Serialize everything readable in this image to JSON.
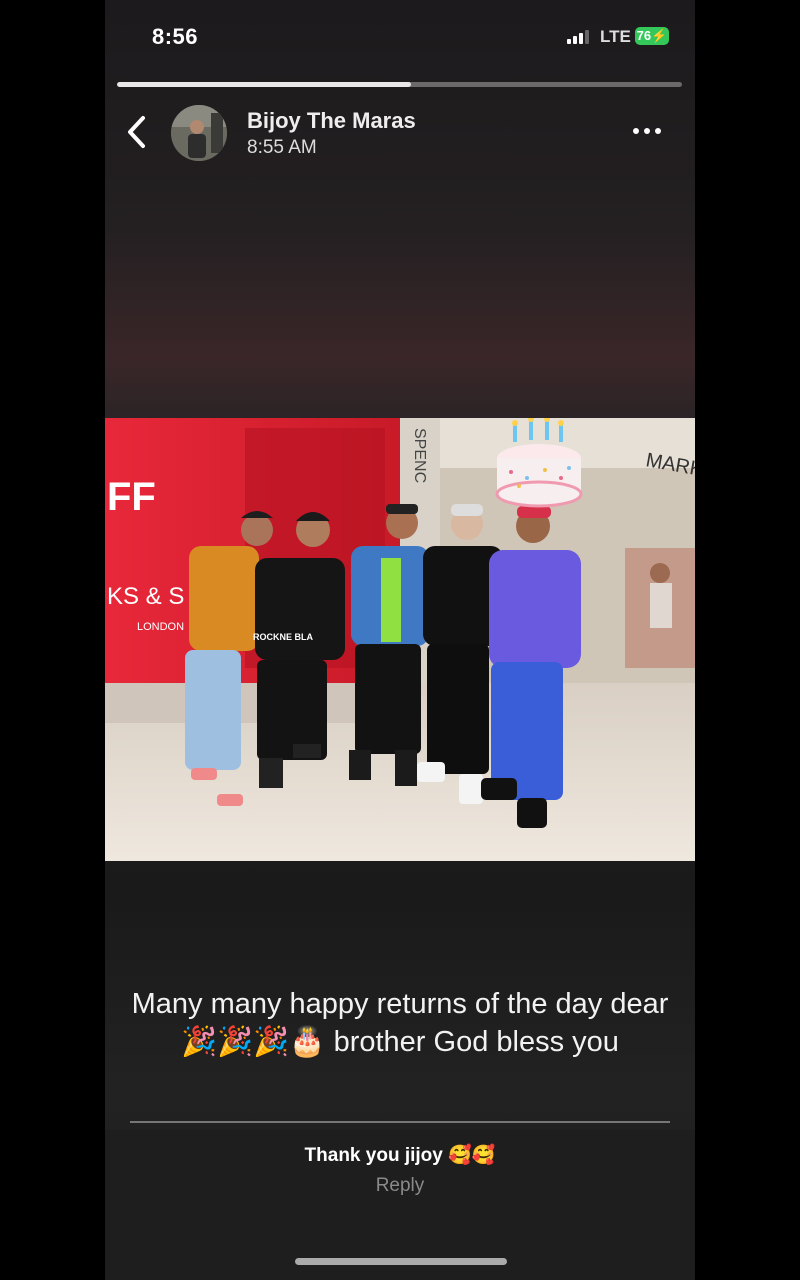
{
  "status_bar": {
    "time": "8:56",
    "network": "LTE",
    "battery": "76⚡"
  },
  "story": {
    "progress": 0.52
  },
  "header": {
    "name": "Bijoy The Maras",
    "time": "8:55 AM"
  },
  "photo": {
    "store_sign_left": "FF",
    "store_sign_left_2": "KS & S",
    "store_sign_left_3": "LONDON",
    "store_sign_right": "MARK",
    "store_sign_pillar": "SPENC",
    "shirt_print": "ROCKNE BLA"
  },
  "caption": "Many many happy returns of the day dear 🎉🎉🎉🎂 brother God bless you",
  "reply": {
    "text": "Thank you jijoy 🥰🥰",
    "button": "Reply"
  },
  "icons": {
    "back": "chevron-left-icon",
    "more": "more-dots-icon",
    "cake": "birthday-cake-sticker"
  }
}
